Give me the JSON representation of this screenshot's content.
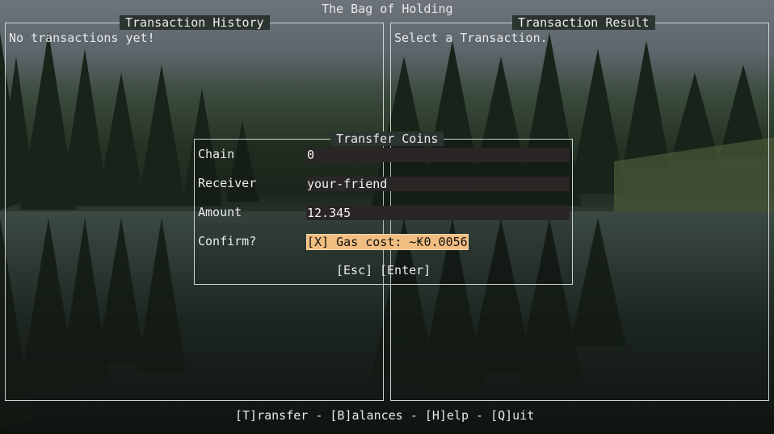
{
  "app": {
    "title": "The Bag of Holding"
  },
  "history": {
    "title": "Transaction History",
    "empty_text": "No transactions yet!"
  },
  "result": {
    "title": "Transaction Result",
    "placeholder": "Select a Transaction."
  },
  "dialog": {
    "title": "Transfer Coins",
    "fields": [
      {
        "label": "Chain",
        "value": "0"
      },
      {
        "label": "Receiver",
        "value": "your-friend"
      },
      {
        "label": "Amount",
        "value": "12.345"
      }
    ],
    "confirm": {
      "label": "Confirm?",
      "value": "[X] Gas cost: ~₭0.0056"
    },
    "buttons": {
      "cancel": "[Esc]",
      "submit": "[Enter]"
    }
  },
  "footer": {
    "transfer": "[T]ransfer",
    "balances": "[B]alances",
    "help": "[H]elp",
    "quit": "[Q]uit",
    "separator": " - "
  },
  "colors": {
    "confirm_highlight": "#f2bd80",
    "input_background": "#2a2626",
    "border": "#cfd3d2"
  }
}
